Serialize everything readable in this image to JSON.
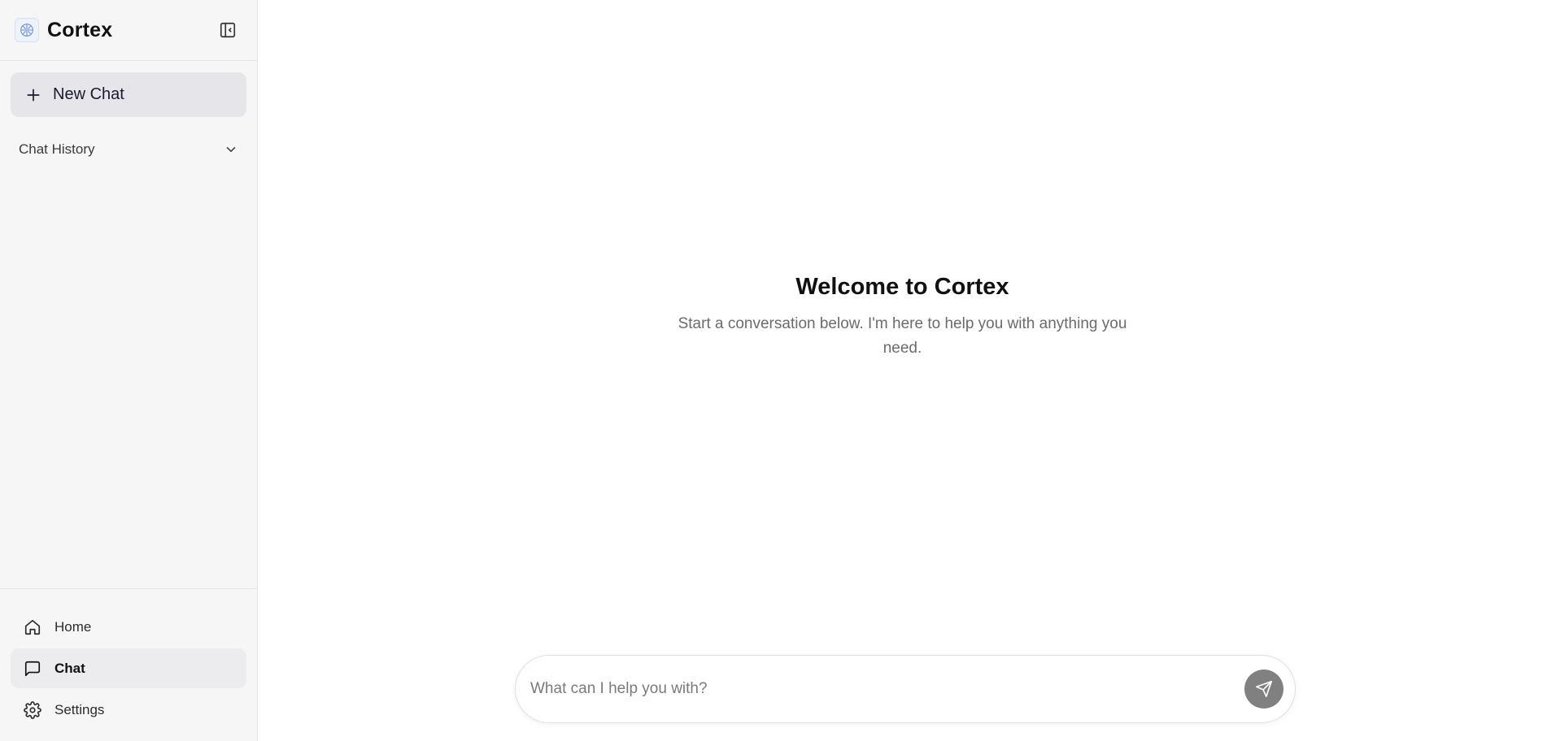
{
  "app": {
    "name": "Cortex"
  },
  "sidebar": {
    "new_chat_label": "New Chat",
    "history_label": "Chat History",
    "nav": [
      {
        "label": "Home",
        "icon": "home-icon",
        "active": false
      },
      {
        "label": "Chat",
        "icon": "chat-icon",
        "active": true
      },
      {
        "label": "Settings",
        "icon": "gear-icon",
        "active": false
      }
    ]
  },
  "main": {
    "welcome_title": "Welcome to Cortex",
    "welcome_subtitle": "Start a conversation below. I'm here to help you with anything you need."
  },
  "composer": {
    "placeholder": "What can I help you with?",
    "value": ""
  },
  "colors": {
    "sidebar_bg": "#f6f6f7",
    "new_chat_bg": "#e6e6ea",
    "send_button": "#808080"
  }
}
